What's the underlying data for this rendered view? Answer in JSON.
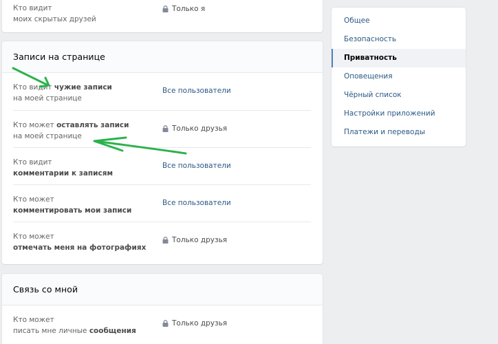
{
  "top_card": {
    "row": {
      "label_line1": "Кто видит",
      "label_line2": "моих скрытых друзей",
      "value": "Только я"
    }
  },
  "posts_card": {
    "title": "Записи на странице",
    "rows": [
      {
        "pre": "Кто видит ",
        "bold": "чужие записи",
        "line2": "на моей странице",
        "value": "Все пользователи",
        "locked": false
      },
      {
        "pre": "Кто может ",
        "bold": "оставлять записи",
        "line2": "на моей странице",
        "value": "Только друзья",
        "locked": true
      },
      {
        "line1": "Кто видит",
        "bold2": "комментарии к записям",
        "value": "Все пользователи",
        "locked": false
      },
      {
        "line1": "Кто может",
        "bold2": "комментировать мои записи",
        "value": "Все пользователи",
        "locked": false
      },
      {
        "line1": "Кто может",
        "bold2": "отмечать меня на фотографиях",
        "value": "Только друзья",
        "locked": true
      }
    ]
  },
  "contact_card": {
    "title": "Связь со мной",
    "row": {
      "line1": "Кто может",
      "pre2": "писать мне личные ",
      "bold2": "сообщения",
      "value": "Только друзья"
    }
  },
  "side_menu": {
    "items": [
      {
        "label": "Общее",
        "active": false
      },
      {
        "label": "Безопасность",
        "active": false
      },
      {
        "label": "Приватность",
        "active": true
      },
      {
        "label": "Оповещения",
        "active": false
      },
      {
        "label": "Чёрный список",
        "active": false
      },
      {
        "label": "Настройки приложений",
        "active": false
      },
      {
        "label": "Платежи и переводы",
        "active": false
      }
    ]
  },
  "colors": {
    "link": "#2a5885",
    "annotation_arrow": "#2bb24c",
    "page_bg": "#edeef0"
  }
}
